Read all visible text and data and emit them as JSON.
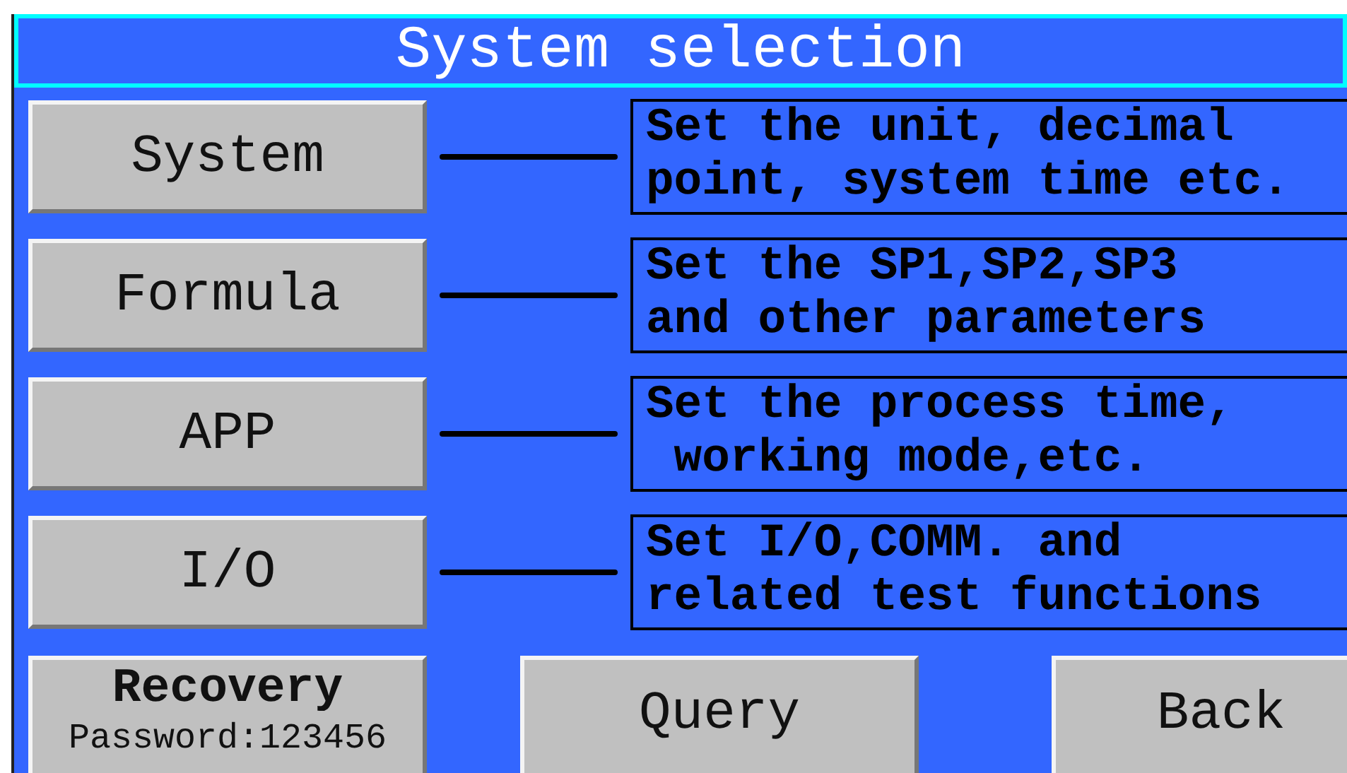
{
  "window": {
    "title": "System selection"
  },
  "menu": [
    {
      "label": "System",
      "description": "Set the unit, decimal\npoint, system time etc."
    },
    {
      "label": "Formula",
      "description": "Set the SP1,SP2,SP3\nand other parameters"
    },
    {
      "label": "APP",
      "description": "Set the process time,\n working mode,etc."
    },
    {
      "label": "I/O",
      "description": "Set I/O,COMM. and\nrelated test functions"
    }
  ],
  "buttons": [
    {
      "kind": "two-line",
      "label": "Recovery",
      "sublabel": "Password:123456"
    },
    {
      "kind": "plain",
      "label": "Query"
    },
    {
      "kind": "plain",
      "label": "Back"
    }
  ]
}
